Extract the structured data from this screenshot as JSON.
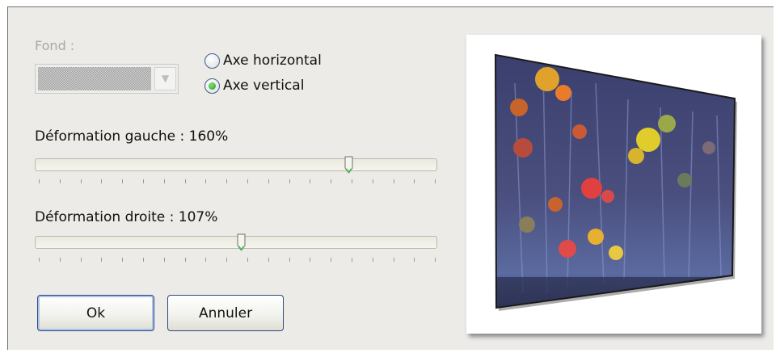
{
  "fond": {
    "label": "Fond :"
  },
  "orientation": {
    "horizontal": {
      "label": "Axe horizontal",
      "selected": false
    },
    "vertical": {
      "label": "Axe vertical",
      "selected": true
    }
  },
  "left_deformation": {
    "label": "Déformation gauche : 160%"
  },
  "right_deformation": {
    "label": "Déformation droite : 107%"
  },
  "buttons": {
    "ok": "Ok",
    "cancel": "Annuler"
  }
}
